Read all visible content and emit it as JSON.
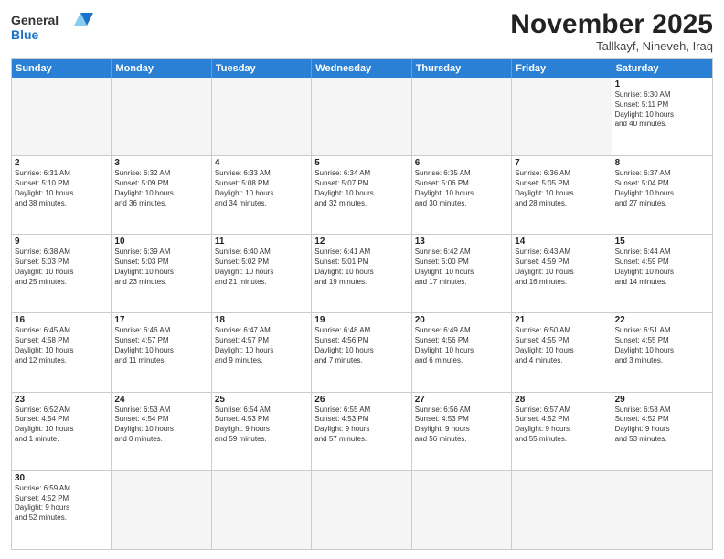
{
  "logo": {
    "text_general": "General",
    "text_blue": "Blue"
  },
  "header": {
    "month": "November 2025",
    "location": "Tallkayf, Nineveh, Iraq"
  },
  "weekdays": [
    "Sunday",
    "Monday",
    "Tuesday",
    "Wednesday",
    "Thursday",
    "Friday",
    "Saturday"
  ],
  "rows": [
    [
      {
        "day": "",
        "empty": true,
        "content": ""
      },
      {
        "day": "",
        "empty": true,
        "content": ""
      },
      {
        "day": "",
        "empty": true,
        "content": ""
      },
      {
        "day": "",
        "empty": true,
        "content": ""
      },
      {
        "day": "",
        "empty": true,
        "content": ""
      },
      {
        "day": "",
        "empty": true,
        "content": ""
      },
      {
        "day": "1",
        "empty": false,
        "content": "Sunrise: 6:30 AM\nSunset: 5:11 PM\nDaylight: 10 hours\nand 40 minutes."
      }
    ],
    [
      {
        "day": "2",
        "content": "Sunrise: 6:31 AM\nSunset: 5:10 PM\nDaylight: 10 hours\nand 38 minutes."
      },
      {
        "day": "3",
        "content": "Sunrise: 6:32 AM\nSunset: 5:09 PM\nDaylight: 10 hours\nand 36 minutes."
      },
      {
        "day": "4",
        "content": "Sunrise: 6:33 AM\nSunset: 5:08 PM\nDaylight: 10 hours\nand 34 minutes."
      },
      {
        "day": "5",
        "content": "Sunrise: 6:34 AM\nSunset: 5:07 PM\nDaylight: 10 hours\nand 32 minutes."
      },
      {
        "day": "6",
        "content": "Sunrise: 6:35 AM\nSunset: 5:06 PM\nDaylight: 10 hours\nand 30 minutes."
      },
      {
        "day": "7",
        "content": "Sunrise: 6:36 AM\nSunset: 5:05 PM\nDaylight: 10 hours\nand 28 minutes."
      },
      {
        "day": "8",
        "content": "Sunrise: 6:37 AM\nSunset: 5:04 PM\nDaylight: 10 hours\nand 27 minutes."
      }
    ],
    [
      {
        "day": "9",
        "content": "Sunrise: 6:38 AM\nSunset: 5:03 PM\nDaylight: 10 hours\nand 25 minutes."
      },
      {
        "day": "10",
        "content": "Sunrise: 6:39 AM\nSunset: 5:03 PM\nDaylight: 10 hours\nand 23 minutes."
      },
      {
        "day": "11",
        "content": "Sunrise: 6:40 AM\nSunset: 5:02 PM\nDaylight: 10 hours\nand 21 minutes."
      },
      {
        "day": "12",
        "content": "Sunrise: 6:41 AM\nSunset: 5:01 PM\nDaylight: 10 hours\nand 19 minutes."
      },
      {
        "day": "13",
        "content": "Sunrise: 6:42 AM\nSunset: 5:00 PM\nDaylight: 10 hours\nand 17 minutes."
      },
      {
        "day": "14",
        "content": "Sunrise: 6:43 AM\nSunset: 4:59 PM\nDaylight: 10 hours\nand 16 minutes."
      },
      {
        "day": "15",
        "content": "Sunrise: 6:44 AM\nSunset: 4:59 PM\nDaylight: 10 hours\nand 14 minutes."
      }
    ],
    [
      {
        "day": "16",
        "content": "Sunrise: 6:45 AM\nSunset: 4:58 PM\nDaylight: 10 hours\nand 12 minutes."
      },
      {
        "day": "17",
        "content": "Sunrise: 6:46 AM\nSunset: 4:57 PM\nDaylight: 10 hours\nand 11 minutes."
      },
      {
        "day": "18",
        "content": "Sunrise: 6:47 AM\nSunset: 4:57 PM\nDaylight: 10 hours\nand 9 minutes."
      },
      {
        "day": "19",
        "content": "Sunrise: 6:48 AM\nSunset: 4:56 PM\nDaylight: 10 hours\nand 7 minutes."
      },
      {
        "day": "20",
        "content": "Sunrise: 6:49 AM\nSunset: 4:56 PM\nDaylight: 10 hours\nand 6 minutes."
      },
      {
        "day": "21",
        "content": "Sunrise: 6:50 AM\nSunset: 4:55 PM\nDaylight: 10 hours\nand 4 minutes."
      },
      {
        "day": "22",
        "content": "Sunrise: 6:51 AM\nSunset: 4:55 PM\nDaylight: 10 hours\nand 3 minutes."
      }
    ],
    [
      {
        "day": "23",
        "content": "Sunrise: 6:52 AM\nSunset: 4:54 PM\nDaylight: 10 hours\nand 1 minute."
      },
      {
        "day": "24",
        "content": "Sunrise: 6:53 AM\nSunset: 4:54 PM\nDaylight: 10 hours\nand 0 minutes."
      },
      {
        "day": "25",
        "content": "Sunrise: 6:54 AM\nSunset: 4:53 PM\nDaylight: 9 hours\nand 59 minutes."
      },
      {
        "day": "26",
        "content": "Sunrise: 6:55 AM\nSunset: 4:53 PM\nDaylight: 9 hours\nand 57 minutes."
      },
      {
        "day": "27",
        "content": "Sunrise: 6:56 AM\nSunset: 4:53 PM\nDaylight: 9 hours\nand 56 minutes."
      },
      {
        "day": "28",
        "content": "Sunrise: 6:57 AM\nSunset: 4:52 PM\nDaylight: 9 hours\nand 55 minutes."
      },
      {
        "day": "29",
        "content": "Sunrise: 6:58 AM\nSunset: 4:52 PM\nDaylight: 9 hours\nand 53 minutes."
      }
    ],
    [
      {
        "day": "30",
        "content": "Sunrise: 6:59 AM\nSunset: 4:52 PM\nDaylight: 9 hours\nand 52 minutes."
      },
      {
        "day": "",
        "empty": true,
        "content": ""
      },
      {
        "day": "",
        "empty": true,
        "content": ""
      },
      {
        "day": "",
        "empty": true,
        "content": ""
      },
      {
        "day": "",
        "empty": true,
        "content": ""
      },
      {
        "day": "",
        "empty": true,
        "content": ""
      },
      {
        "day": "",
        "empty": true,
        "content": ""
      }
    ]
  ]
}
